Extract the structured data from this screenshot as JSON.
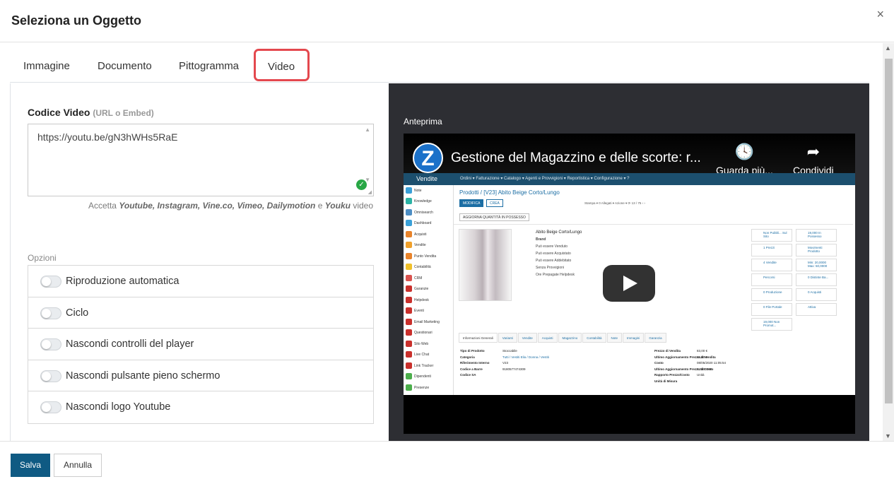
{
  "dialog": {
    "title": "Seleziona un Oggetto",
    "close_icon": "×"
  },
  "tabs": [
    {
      "label": "Immagine"
    },
    {
      "label": "Documento"
    },
    {
      "label": "Pittogramma"
    },
    {
      "label": "Video",
      "active": true,
      "highlight_color": "#e4484e"
    }
  ],
  "video_code": {
    "label": "Codice Video",
    "hint": "(URL o Embed)",
    "value": "https://youtu.be/gN3hWHs5RaE",
    "accept_prefix": "Accetta",
    "accept_sources_1": "Youtube, Instagram, Vine.co, Vimeo, Dailymotion",
    "accept_and": "e",
    "accept_source_last": "Youku",
    "accept_suffix": "video"
  },
  "options": {
    "label": "Opzioni",
    "items": [
      {
        "label": "Riproduzione automatica",
        "enabled": false
      },
      {
        "label": "Ciclo",
        "enabled": false
      },
      {
        "label": "Nascondi controlli del player",
        "enabled": false
      },
      {
        "label": "Nascondi pulsante pieno schermo",
        "enabled": false
      },
      {
        "label": "Nascondi logo Youtube",
        "enabled": false
      }
    ]
  },
  "preview": {
    "label": "Anteprima",
    "video_title": "Gestione del Magazzino e delle scorte: r...",
    "watch_later": "Guarda più...",
    "share": "Condividi",
    "channel_logo": "Z",
    "screen": {
      "app": "Vendite",
      "menu": "Ordini ▾   Fatturazione ▾   Catalogo ▾   Agenti e Provvigioni ▾   Reportistica ▾   Configurazione ▾   ?",
      "breadcrumb": "Prodotti / [V23] Abito Beige Corto/Lungo",
      "btn_edit": "MODIFICA",
      "btn_create": "CREA",
      "btn_update_qty": "AGGIORNA QUANTITÀ IN POSSESSO",
      "actions": "Stampa ▾     0 Allegati ▾     Azione ▾          ⟳   13 / 75   ‹   ›",
      "product_name": "Abito Beige Corto/Lungo",
      "brand_label": "Brand",
      "checks": [
        "Può essere Venduto",
        "Può essere Acquistato",
        "Può essere Addebitato",
        "Senza Provvigioni",
        "Ore Prepagate Helpdesk"
      ],
      "side_items": [
        "Note",
        "Knowledge",
        "Omnisearch",
        "Dashboard",
        "Acquisti",
        "Vendite",
        "Punto Vendita",
        "Contabilità",
        "CRM",
        "Garanzie",
        "Helpdesk",
        "Eventi",
        "Email Marketing",
        "Questionari",
        "Sito Web",
        "Live Chat",
        "Link Tracker",
        "Dipendenti",
        "Presenze"
      ],
      "stats": [
        "Non Pubbli... Sul Sito",
        "19,000 In Possesso",
        "1 Prezzi",
        "Movimenti Prodotto",
        "4 Vendite",
        "Min: 20,0000 Max: 50,0000",
        "Percorsi",
        "0 Distinte Ba...",
        "0 Produzione",
        "0 Acquisti",
        "0 File Portale",
        "Attiva",
        "19,000 Non Promot..."
      ],
      "subtabs": [
        "Informazioni Generali",
        "Varianti",
        "Vendite",
        "Acquisti",
        "Magazzino",
        "Contabilità",
        "Note",
        "Immagini",
        "Garanzia"
      ],
      "details_left_labels": [
        "Tipo di Prodotto",
        "Categoria",
        "Riferimento Interno",
        "Codice a Barre",
        "Codice SA"
      ],
      "details_left_values": [
        "Stoccabile",
        "Tutti / Vestiti Elia / Donna / Vestiti",
        "V23",
        "9180577474309",
        ""
      ],
      "details_right_labels": [
        "Prezzo di Vendita",
        "Ultimo Aggiornamento Prezzo di Vendita",
        "Costo",
        "Ultimo Aggiornamento Prezzo di Costo",
        "Rapporto Prezzo/Costo",
        "Unità di Misura"
      ],
      "details_right_values": [
        "83,00 €",
        "",
        "15,00 €",
        "08/05/2020 11:05:54",
        "5,0000000",
        "Unità"
      ]
    }
  },
  "footer": {
    "save": "Salva",
    "cancel": "Annulla"
  }
}
